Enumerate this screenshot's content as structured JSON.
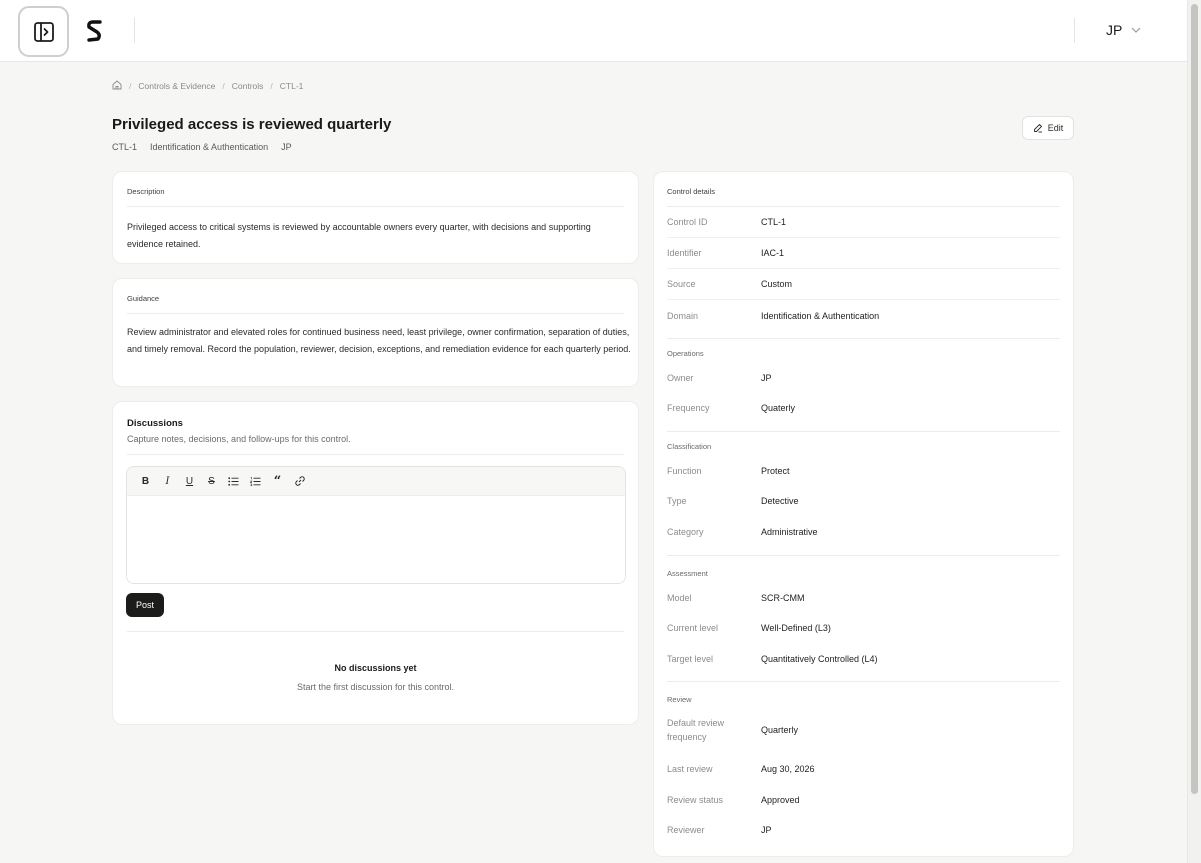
{
  "header": {
    "sidebar_toggle_icon": "panel-toggle-icon",
    "logo_icon": "brand-logo-icon",
    "user_initials": "JP",
    "user_chevron_icon": "chevron-down-icon"
  },
  "breadcrumb": {
    "home_icon": "home-icon",
    "separator": "/",
    "items": [
      "Controls & Evidence",
      "Controls",
      "CTL-1"
    ]
  },
  "page": {
    "title": "Privileged access is reviewed quarterly",
    "meta": [
      "CTL-1",
      "Identification & Authentication",
      "JP"
    ],
    "edit_label": "Edit",
    "edit_icon": "pencil-icon"
  },
  "description": {
    "label": "Description",
    "text": "Privileged access to critical systems is reviewed by accountable owners every quarter, with decisions and supporting evidence retained."
  },
  "guidance": {
    "label": "Guidance",
    "text": "Review administrator and elevated roles for continued business need, least privilege, owner confirmation, separation of duties, and timely removal. Record the population, reviewer, decision, exceptions, and remediation evidence for each quarterly period."
  },
  "discussions": {
    "title": "Discussions",
    "subtitle": "Capture notes, decisions, and follow-ups for this control.",
    "toolbar": [
      "bold-icon",
      "italic-icon",
      "underline-icon",
      "strikethrough-icon",
      "bullet-list-icon",
      "ordered-list-icon",
      "quote-icon",
      "link-icon"
    ],
    "post_label": "Post",
    "empty_title": "No discussions yet",
    "empty_subtitle": "Start the first discussion for this control."
  },
  "details": {
    "title": "Control details",
    "general": [
      {
        "key": "Control ID",
        "value": "CTL-1"
      },
      {
        "key": "Identifier",
        "value": "IAC-1"
      },
      {
        "key": "Source",
        "value": "Custom"
      },
      {
        "key": "Domain",
        "value": "Identification & Authentication"
      }
    ],
    "operations": {
      "label": "Operations",
      "rows": [
        {
          "key": "Owner",
          "value": "JP"
        },
        {
          "key": "Frequency",
          "value": "Quaterly"
        }
      ]
    },
    "classification": {
      "label": "Classification",
      "rows": [
        {
          "key": "Function",
          "value": "Protect"
        },
        {
          "key": "Type",
          "value": "Detective"
        },
        {
          "key": "Category",
          "value": "Administrative"
        }
      ]
    },
    "assessment": {
      "label": "Assessment",
      "rows": [
        {
          "key": "Model",
          "value": "SCR-CMM"
        },
        {
          "key": "Current level",
          "value": "Well-Defined (L3)"
        },
        {
          "key": "Target level",
          "value": "Quantitatively Controlled (L4)"
        }
      ]
    },
    "review": {
      "label": "Review",
      "rows": [
        {
          "key": "Default review frequency",
          "value": "Quarterly"
        },
        {
          "key": "Last review",
          "value": "Aug 30, 2026"
        },
        {
          "key": "Review status",
          "value": "Approved"
        },
        {
          "key": "Reviewer",
          "value": "JP"
        }
      ]
    }
  }
}
